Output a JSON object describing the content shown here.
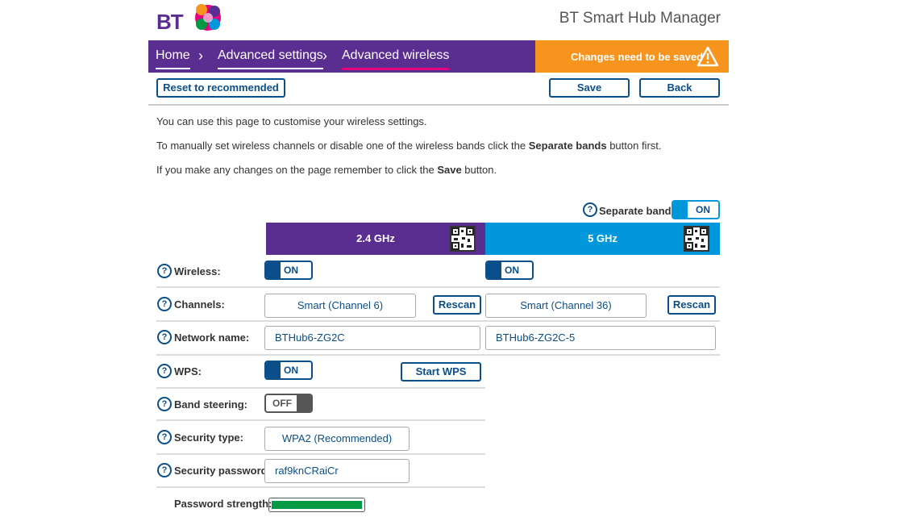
{
  "header": {
    "logo_text": "BT",
    "app_title": "BT Smart Hub Manager"
  },
  "breadcrumb": {
    "home": "Home",
    "advanced_settings": "Advanced settings",
    "advanced_wireless": "Advanced wireless"
  },
  "notice": {
    "text": "Changes need to be saved",
    "icon": "warning-icon",
    "color": "#f7941d"
  },
  "toolbar": {
    "reset_label": "Reset to recommended",
    "save_label": "Save",
    "back_label": "Back"
  },
  "intro": {
    "line1": "You can use this page to customise your wireless settings.",
    "line2_prefix": "To manually set wireless channels or disable one of the wireless bands click the ",
    "line2_bold": "Separate bands",
    "line2_suffix": " button first.",
    "line3_prefix": "If you make any changes on the page remember to click the ",
    "line3_bold": "Save",
    "line3_suffix": " button."
  },
  "separate_bands": {
    "label": "Separate bands",
    "state": "ON"
  },
  "bands": {
    "b24": {
      "label": "2.4 GHz",
      "color": "#5a2d91"
    },
    "b5": {
      "label": "5 GHz",
      "color": "#0098db"
    }
  },
  "rows": {
    "wireless": {
      "label": "Wireless:",
      "b24_state": "ON",
      "b5_state": "ON"
    },
    "channels": {
      "label": "Channels:",
      "b24_value": "Smart (Channel 6)",
      "b5_value": "Smart (Channel 36)",
      "rescan_label": "Rescan"
    },
    "network_name": {
      "label": "Network name:",
      "b24_value": "BTHub6-ZG2C",
      "b5_value": "BTHub6-ZG2C-5"
    },
    "wps": {
      "label": "WPS:",
      "state": "ON",
      "start_label": "Start WPS"
    },
    "band_steering": {
      "label": "Band steering:",
      "state": "OFF"
    },
    "security_type": {
      "label": "Security type:",
      "value": "WPA2 (Recommended)"
    },
    "security_password": {
      "label": "Security password:",
      "value": "raf9knCRaiCr"
    },
    "password_strength": {
      "label": "Password strength:",
      "level": 1.0,
      "color": "#009a44"
    }
  },
  "help_glyph": "?"
}
